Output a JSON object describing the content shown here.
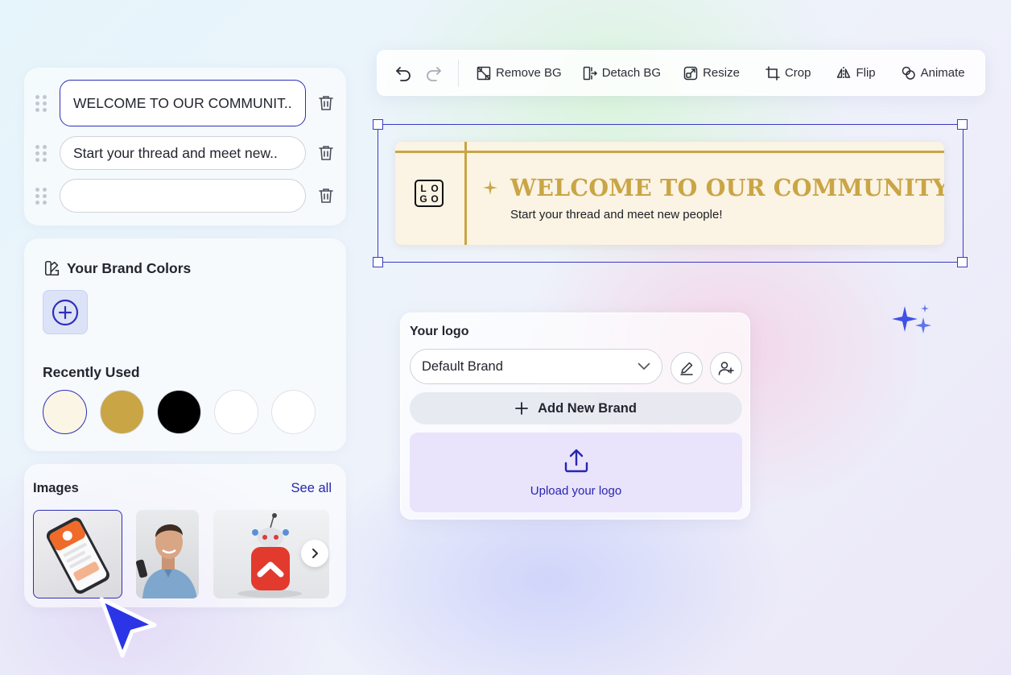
{
  "text_fields": [
    {
      "value": "WELCOME TO OUR COMMUNIT.."
    },
    {
      "value": "Start your thread and meet new.."
    },
    {
      "value": ""
    }
  ],
  "brand_colors": {
    "title": "Your Brand Colors",
    "recently_used_title": "Recently Used",
    "swatches": [
      "#fbf5e6",
      "#c9a545",
      "#000000",
      "#ffffff",
      "#ffffff"
    ]
  },
  "images": {
    "title": "Images",
    "see_all": "See all"
  },
  "toolbar": {
    "remove_bg": "Remove BG",
    "detach_bg": "Detach BG",
    "resize": "Resize",
    "crop": "Crop",
    "flip": "Flip",
    "animate": "Animate"
  },
  "banner": {
    "logo_text": "LOGO",
    "title": "WELCOME TO OUR COMMUNITY",
    "subtitle": "Start your thread and meet new people!",
    "gold": "#c9a545",
    "bg": "#fbf3e4"
  },
  "logo_panel": {
    "title": "Your logo",
    "selected_brand": "Default Brand",
    "add_brand": "Add New Brand",
    "upload": "Upload your logo"
  },
  "colors": {
    "accent": "#2f2fb8",
    "link": "#2626b0",
    "upload_bg": "#e9e3fb"
  }
}
